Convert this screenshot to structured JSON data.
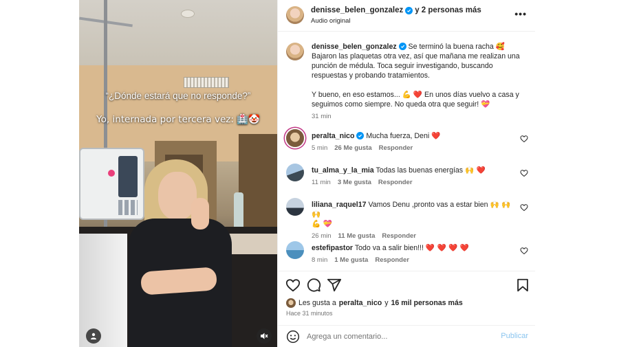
{
  "colors": {
    "accent": "#0095f6",
    "heart": "#ff2f54",
    "text_primary": "#262626",
    "text_secondary": "#737373",
    "publish_disabled": "#89c4ef"
  },
  "media": {
    "overlay_line_1": "“¿Dónde estará que no responde?”",
    "overlay_line_2": "Yo, internada por tercera vez: 🏥🤡",
    "tag_icon": "user-tag-icon",
    "mute_icon": "speaker-muted-icon"
  },
  "header": {
    "username": "denisse_belen_gonzalez",
    "collab_text": "y 2 personas más",
    "audio": "Audio original",
    "more_icon": "more-horizontal-icon"
  },
  "caption": {
    "username": "denisse_belen_gonzalez",
    "line_1_text": "Se terminó la buena racha",
    "line_1_emoji": "🥰",
    "line_2": "Bajaron las plaquetas otra vez, así que mañana me realizan una",
    "line_3": "punción de médula. Toca seguir investigando, buscando",
    "line_4": "respuestas y probando tratamientos.",
    "line_5_text": "Y bueno, en eso estamos...",
    "line_5_emoji_1": "💪",
    "line_5_emoji_2": "❤️",
    "line_5_rest": "En unos días vuelvo a casa y",
    "line_6_text": "seguimos como siempre. No queda otra que seguir!",
    "line_6_emoji": "💝",
    "time": "31 min"
  },
  "comments": [
    {
      "username": "peralta_nico",
      "verified": true,
      "text": "Mucha fuerza, Deni",
      "emoji": "❤️",
      "time": "5 min",
      "likes": "26 Me gusta",
      "reply": "Responder"
    },
    {
      "username": "tu_alma_y_la_mia",
      "verified": false,
      "text": "Todas las buenas energías",
      "emoji": "🙌 ❤️",
      "time": "11 min",
      "likes": "3 Me gusta",
      "reply": "Responder"
    },
    {
      "username": "liliana_raquel17",
      "verified": false,
      "text": "Vamos Denu ,pronto vas a estar bien",
      "emoji": "🙌 🙌 🙌",
      "emoji_line_2": "💪 💝",
      "time": "26 min",
      "likes": "11 Me gusta",
      "reply": "Responder"
    },
    {
      "username": "estefipastor",
      "verified": false,
      "text": "Todo va a salir bien!!!",
      "emoji": "❤️ ❤️ ❤️ ❤️",
      "time": "8 min",
      "likes": "1 Me gusta",
      "reply": "Responder"
    }
  ],
  "actions": {
    "like_icon": "heart-icon",
    "comment_icon": "comment-icon",
    "share_icon": "share-icon",
    "save_icon": "bookmark-icon",
    "likes_prefix": "Les gusta a",
    "likes_user": "peralta_nico",
    "likes_connector": "y",
    "likes_others": "16 mil personas más",
    "post_time": "Hace 31 minutos"
  },
  "add_comment": {
    "placeholder": "Agrega un comentario...",
    "post_label": "Publicar",
    "emoji_icon": "emoji-smile-icon"
  }
}
